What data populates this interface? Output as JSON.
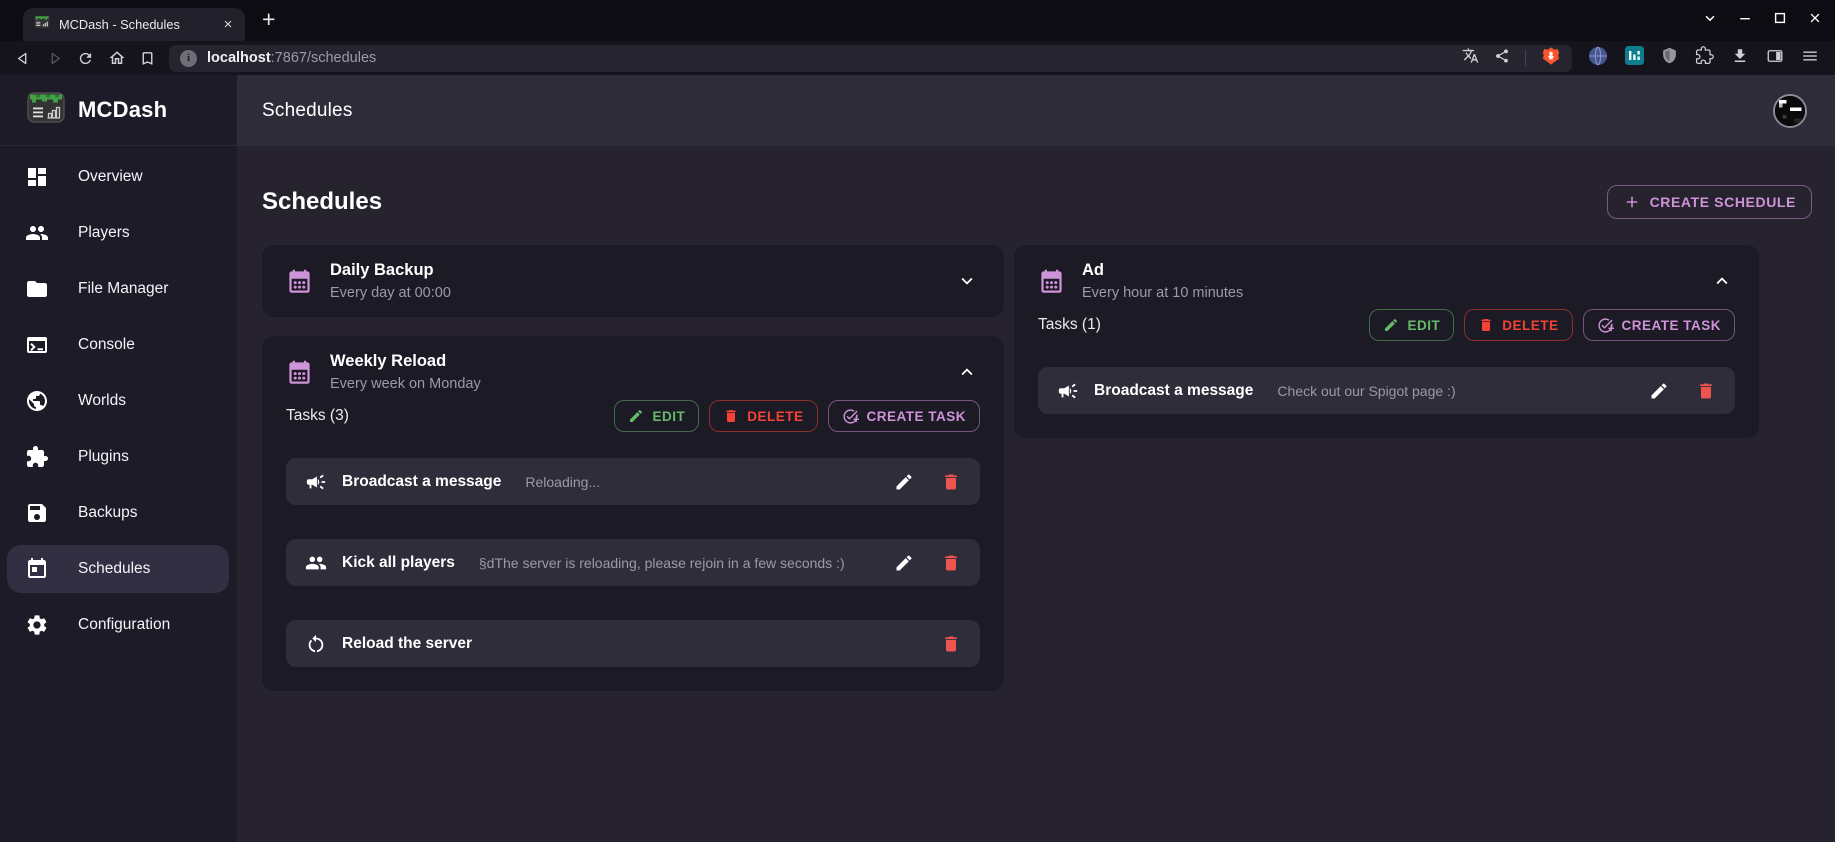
{
  "browser": {
    "tab_title": "MCDash - Schedules",
    "url_host": "localhost",
    "url_rest": ":7867/schedules",
    "info_glyph": "i",
    "new_tab_glyph": "+",
    "close_tab_glyph": "×"
  },
  "sidebar": {
    "brand": "MCDash",
    "items": [
      {
        "label": "Overview",
        "icon": "dashboard-icon",
        "active": false
      },
      {
        "label": "Players",
        "icon": "players-icon",
        "active": false
      },
      {
        "label": "File Manager",
        "icon": "folder-icon",
        "active": false
      },
      {
        "label": "Console",
        "icon": "terminal-icon",
        "active": false
      },
      {
        "label": "Worlds",
        "icon": "globe-icon",
        "active": false
      },
      {
        "label": "Plugins",
        "icon": "puzzle-icon",
        "active": false
      },
      {
        "label": "Backups",
        "icon": "save-icon",
        "active": false
      },
      {
        "label": "Schedules",
        "icon": "calendar-icon",
        "active": true
      },
      {
        "label": "Configuration",
        "icon": "gear-icon",
        "active": false
      }
    ]
  },
  "header": {
    "title": "Schedules"
  },
  "main": {
    "heading": "Schedules",
    "create_schedule_label": "CREATE SCHEDULE",
    "schedules": [
      {
        "name": "Daily Backup",
        "frequency": "Every day at 00:00",
        "expanded": false
      },
      {
        "name": "Weekly Reload",
        "frequency": "Every week on Monday",
        "expanded": true,
        "tasks_label": "Tasks (3)",
        "edit_label": "EDIT",
        "delete_label": "DELETE",
        "create_task_label": "CREATE TASK",
        "tasks": [
          {
            "name": "Broadcast a message",
            "detail": "Reloading...",
            "icon": "megaphone-icon"
          },
          {
            "name": "Kick all players",
            "detail": "§dThe server is reloading, please rejoin in a few seconds :)",
            "icon": "players-icon"
          },
          {
            "name": "Reload the server",
            "detail": "",
            "icon": "restart-icon"
          }
        ]
      },
      {
        "name": "Ad",
        "frequency": "Every hour at 10 minutes",
        "expanded": true,
        "tasks_label": "Tasks (1)",
        "edit_label": "EDIT",
        "delete_label": "DELETE",
        "create_task_label": "CREATE TASK",
        "tasks": [
          {
            "name": "Broadcast a message",
            "detail": "Check out our Spigot page :)",
            "icon": "megaphone-icon"
          }
        ]
      }
    ]
  },
  "colors": {
    "accent_purple": "#ce93d8",
    "success_green": "#66bb6a",
    "danger_red": "#f44336",
    "trash_red": "#ef5350",
    "brave_orange": "#fb542b",
    "sidebar_bg": "#1d1b27",
    "appbar_bg": "#2f2c3a",
    "content_bg": "#26232f",
    "card_bg": "#1c1a24",
    "task_row_bg": "#2f2d3a"
  }
}
